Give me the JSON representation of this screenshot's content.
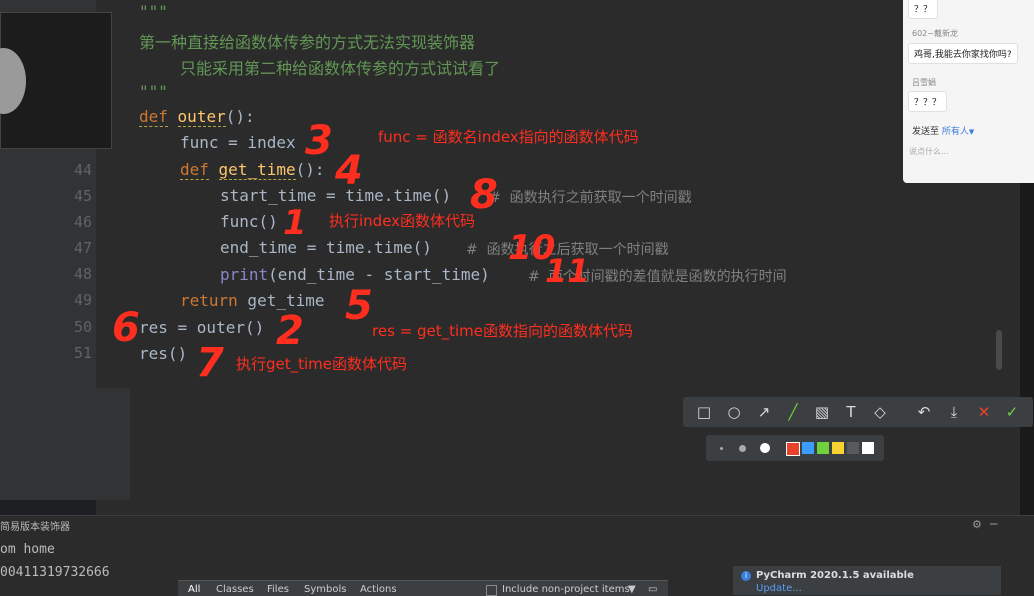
{
  "editor": {
    "docstring_open": "\"\"\"",
    "docstring_line1": "第一种直接给函数体传参的方式无法实现装饰器",
    "docstring_line2": "只能采用第二种给函数体传参的方式试试看了",
    "docstring_close": "\"\"\"",
    "line_numbers": [
      "44",
      "45",
      "46",
      "47",
      "48",
      "49",
      "50",
      "51"
    ],
    "code": {
      "def_kw": "def",
      "outer_name": "outer",
      "outer_tail": "():",
      "func_assign": "func = index",
      "def_kw2": "def",
      "get_time_name": "get_time",
      "get_time_tail": "():",
      "start_time": "start_time = time.time()",
      "start_comment": "#  函数执行之前获取一个时间戳",
      "func_call": "func()",
      "end_time": "end_time = time.time()",
      "end_comment": "#  函数执行之后获取一个时间戳",
      "print_kw": "print",
      "print_args": "(end_time - start_time)",
      "print_comment": "#  两个时间戳的差值就是函数的执行时间",
      "return_kw": "return",
      "return_val": " get_time",
      "res_assign": "res = outer()",
      "res_call": "res()"
    }
  },
  "annotations": {
    "func_note": "func = 函数名index指向的函数体代码",
    "exec_index": "执行index函数体代码",
    "res_note": "res = get_time函数指向的函数体代码",
    "exec_get_time": "执行get_time函数体代码",
    "n1": "1",
    "n2": "2",
    "n3": "3",
    "n4": "4",
    "n5": "5",
    "n6": "6",
    "n7": "7",
    "n8": "8",
    "n10": "10",
    "n11": "11"
  },
  "chat": {
    "msg_top": "？？",
    "sender2": "602~戴新龙",
    "msg2": "鸡哥,我能去你家找你吗?",
    "sender3": "吕雪娟",
    "msg3": "？？？",
    "send_to_label": "发送至",
    "send_to_value": "所有人",
    "input_placeholder": "说点什么..."
  },
  "run_panel": {
    "tab_label": "简易版本装饰器",
    "output_line1": "om home",
    "output_line2": "00411319732666"
  },
  "search_tabs": [
    "All",
    "Classes",
    "Files",
    "Symbols",
    "Actions"
  ],
  "search_checkbox_label": "Include non-project items",
  "notification": {
    "title": "PyCharm 2020.1.5 available",
    "link": "Update..."
  },
  "colors": {
    "palette": [
      "#e8412c",
      "#3b9cff",
      "#6fd13e",
      "#f3d232",
      "#5a5a5a",
      "#ffffff"
    ]
  }
}
